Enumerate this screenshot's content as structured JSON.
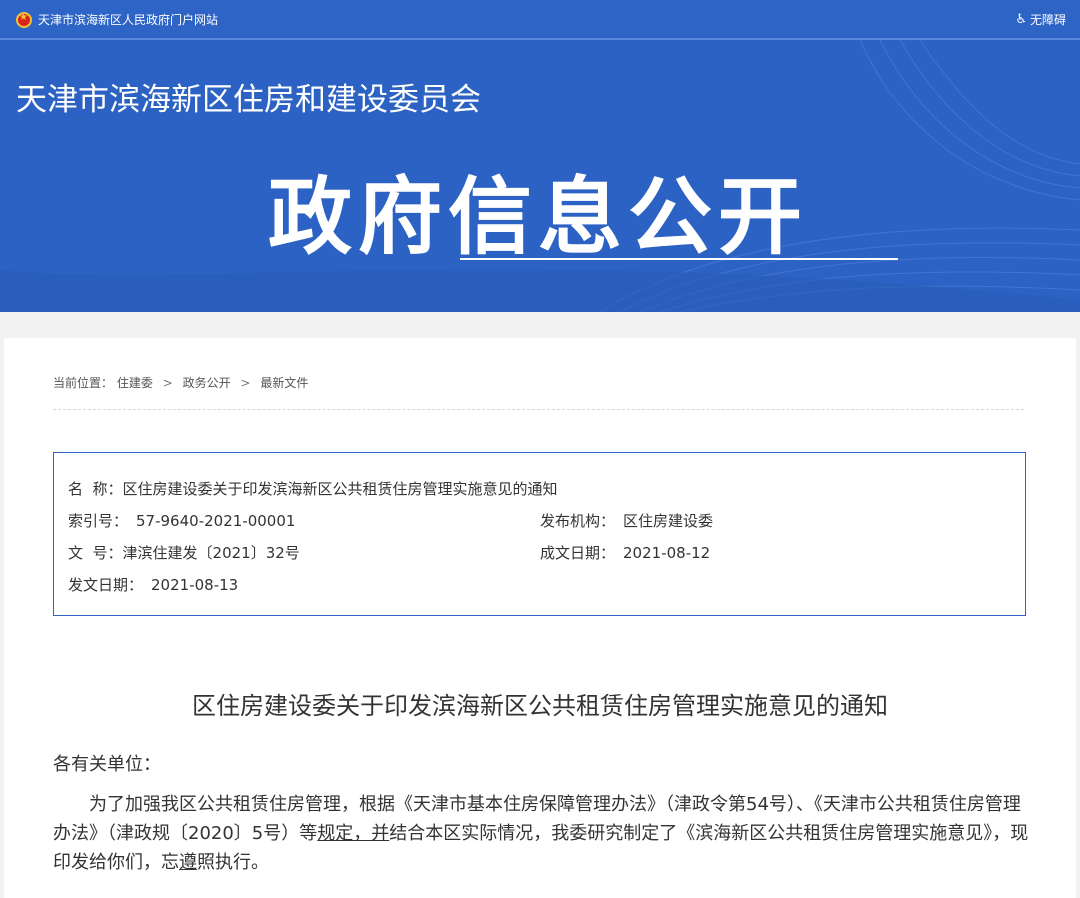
{
  "topbar": {
    "portal_label": "天津市滨海新区人民政府门户网站",
    "accessibility_label": "无障碍",
    "emblem_icon": "national-emblem-icon",
    "accessibility_icon": "wheelchair-icon"
  },
  "banner": {
    "site_title": "天津市滨海新区住房和建设委员会",
    "section_title": "政府信息公开"
  },
  "breadcrumb": {
    "prefix": "当前位置：",
    "items": [
      "住建委",
      "政务公开",
      "最新文件"
    ],
    "separator": ">"
  },
  "info": {
    "name_label": "名  称：",
    "name_value": "区住房建设委关于印发滨海新区公共租赁住房管理实施意见的通知",
    "index_label": "索引号：",
    "index_value": "57-9640-2021-00001",
    "publisher_label": "发布机构：",
    "publisher_value": "区住房建设委",
    "docno_label": "文  号：",
    "docno_value": "津滨住建发〔2021〕32号",
    "created_label": "成文日期：",
    "created_value": "2021-08-12",
    "issued_label": "发文日期：",
    "issued_value": "2021-08-13"
  },
  "document": {
    "title": "区住房建设委关于印发滨海新区公共租赁住房管理实施意见的通知",
    "greeting": "各有关单位：",
    "para_part1": "为了加强我区公共租赁住房管理，根据《天津市基本住房保障管理办法》（津政令第54号）、《天津市公共租赁住房管理办法》（津政规〔2020〕5号）等",
    "para_underlined": "规定，并",
    "para_part2": "结合本区实际情况，我委研究制定了《滨海新区公共租赁住房管理实施意见》，现印发给你们，",
    "para_part3": "忘",
    "para_underlined2": "遵",
    "para_part4": "照执行。"
  },
  "colors": {
    "brand_blue": "#2d64c6",
    "box_border": "#2d64c6"
  }
}
